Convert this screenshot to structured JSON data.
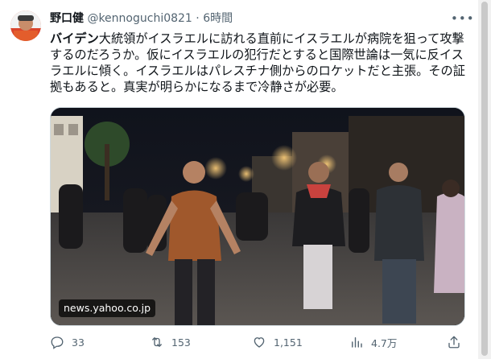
{
  "tweet": {
    "author_name": "野口健",
    "handle": "@kennoguchi0821",
    "separator": "·",
    "time": "6時間",
    "text_bold": "バイデン",
    "text_rest": "大統領がイスラエルに訪れる直前にイスラエルが病院を狙って攻撃するのだろうか。仮にイスラエルの犯行だとすると国際世論は一気に反イスラエルに傾く。イスラエルはパレスチナ側からのロケットだと主張。その証拠もあると。真実が明らかになるまで冷静さが必要。",
    "media_source": "news.yahoo.co.jp"
  },
  "actions": {
    "replies": "33",
    "retweets": "153",
    "likes": "1,151",
    "views": "4.7万"
  },
  "icons": {
    "more": "more-icon",
    "reply": "reply-icon",
    "retweet": "retweet-icon",
    "like": "heart-icon",
    "views": "views-icon",
    "share": "share-icon"
  },
  "colors": {
    "text": "#0f1419",
    "secondary": "#536471",
    "retweet": "#00ba7c"
  }
}
